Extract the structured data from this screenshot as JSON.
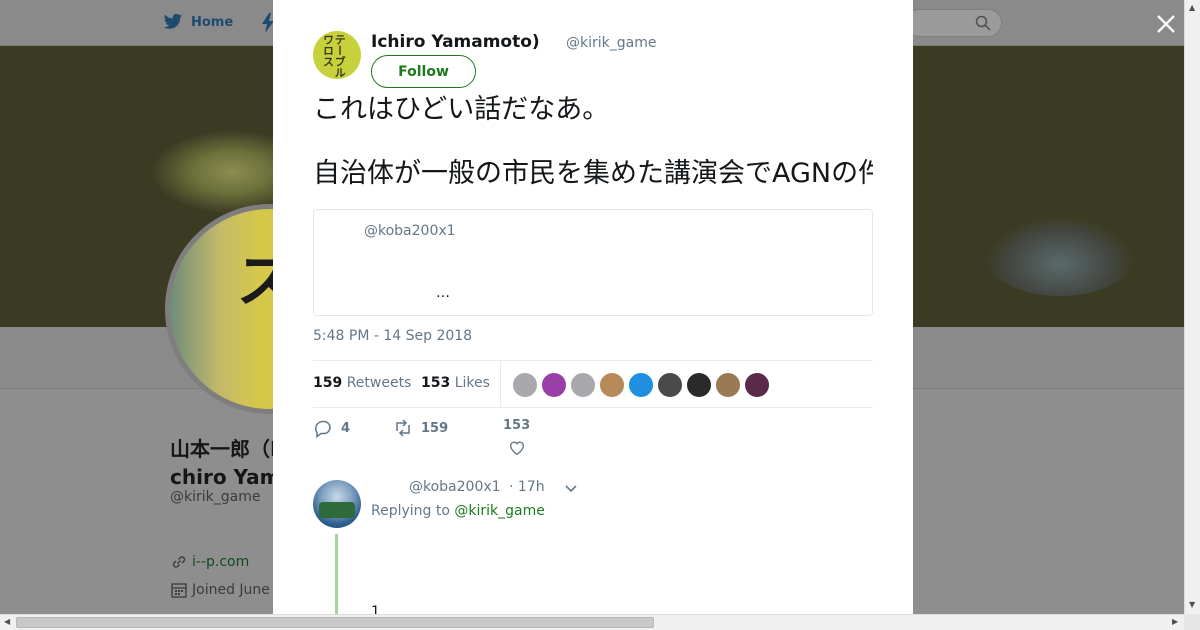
{
  "nav": {
    "home_label": "Home",
    "icons": [
      "twitter-bird-icon",
      "lightning-icon",
      "search-icon"
    ]
  },
  "profile": {
    "name": "山本一郎（Ichiro Yamamoto）",
    "name_visible": "山本一郎（Ichi\nYamamo",
    "handle": "@kirik_game",
    "url": "i--p.com",
    "joined": "Joined June",
    "avatar_text": "ワロス"
  },
  "tweet": {
    "author_name": "Ichiro Yamamoto)",
    "author_handle": "@kirik_game",
    "follow_label": "Follow",
    "avatar_text": "テーブルワロス",
    "text_line1": "これはひどい話だなあ。",
    "text_line2": "自治体が一般の市民を集めた講演会でAGNの件、こういうことするのは本当に問題だと思うんですがどうなんでしょうか。",
    "quote": {
      "handle": "@koba200x1",
      "ellipsis": "…"
    },
    "timestamp": "5:48 PM - 14 Sep 2018",
    "retweets_count": "159",
    "retweets_label": "Retweets",
    "likes_count": "153",
    "likes_label": "Likes",
    "liker_colors": [
      "#a8a8ad",
      "#9a3fa8",
      "#a8a8ad",
      "#b78a5a",
      "#1f8fe0",
      "#4a4a4a",
      "#2a2a2a",
      "#9a7a55",
      "#5a2a4a"
    ],
    "actions": {
      "reply_count": "4",
      "retweet_count": "159",
      "like_count": "153"
    }
  },
  "reply": {
    "handle": "@koba200x1",
    "time": "· 17h",
    "replying_prefix": "Replying to",
    "replying_to": "@kirik_game",
    "text_partial": "1"
  },
  "colors": {
    "accent": "#1d7a1d",
    "muted": "#657786",
    "text": "#14171a",
    "overlay": "#8e8e8e"
  }
}
